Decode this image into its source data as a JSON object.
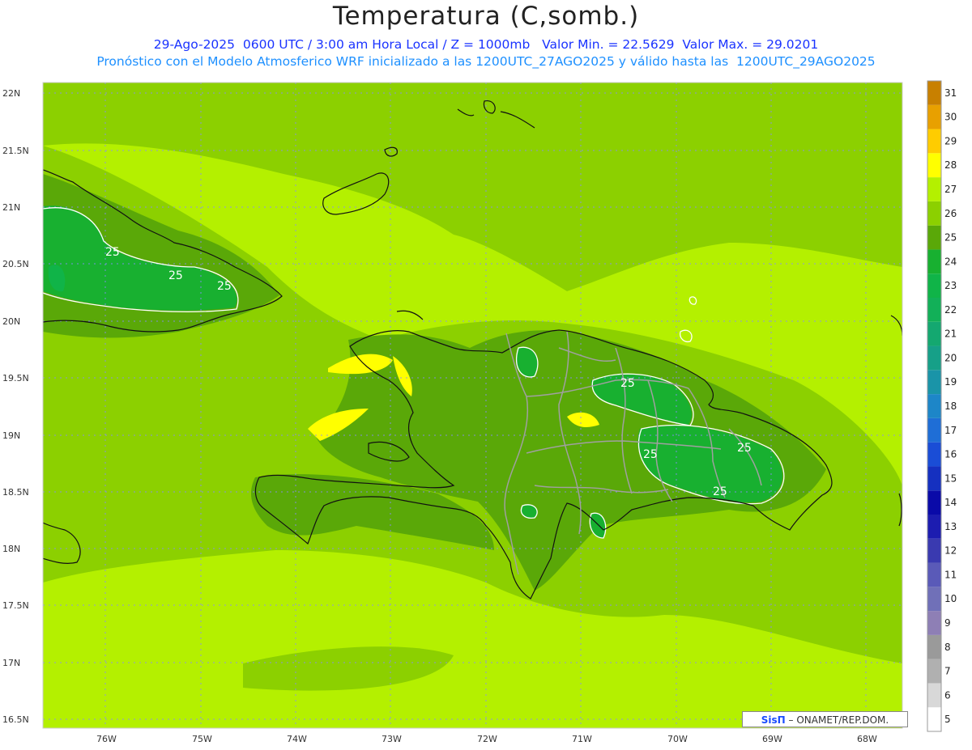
{
  "header": {
    "title": "Temperatura (C,somb.)",
    "line1": "29-Ago-2025  0600 UTC / 3:00 am Hora Local / Z = 1000mb   Valor Min. = 22.5629  Valor Max. = 29.0201",
    "line2": "Pronóstico con el Modelo Atmosferico WRF inicializado a las 1200UTC_27AGO2025 y válido hasta las  1200UTC_29AGO2025"
  },
  "axes": {
    "lat_labels": [
      "22N",
      "21.5N",
      "21N",
      "20.5N",
      "20N",
      "19.5N",
      "19N",
      "18.5N",
      "18N",
      "17.5N",
      "17N",
      "16.5N"
    ],
    "lon_labels": [
      "76W",
      "75W",
      "74W",
      "73W",
      "72W",
      "71W",
      "70W",
      "69W",
      "68W"
    ]
  },
  "colorbar": {
    "levels": [
      "5",
      "6",
      "7",
      "8",
      "9",
      "10",
      "11",
      "12",
      "13",
      "14",
      "15",
      "16",
      "17",
      "18",
      "19",
      "20",
      "21",
      "22",
      "23",
      "24",
      "25",
      "26",
      "27",
      "28",
      "29",
      "30",
      "31"
    ],
    "colors": [
      "#ffffff",
      "#d8d8d8",
      "#b0b0b0",
      "#9a9a9a",
      "#8e7fb5",
      "#7070b8",
      "#5a5ab8",
      "#3a3ab0",
      "#1c1cb0",
      "#0a0aa8",
      "#1530c0",
      "#1a4dd6",
      "#1f6ed6",
      "#1d86c8",
      "#1a94a8",
      "#16a088",
      "#14a870",
      "#12b058",
      "#10b448",
      "#18b030",
      "#5aa808",
      "#8cd000",
      "#b4f000",
      "#ffff00",
      "#ffcc00",
      "#e8a000",
      "#c88000"
    ]
  },
  "contour_labels": [
    "25",
    "25",
    "25",
    "25",
    "25",
    "25",
    "25"
  ],
  "credit": {
    "brand": "SisΠ",
    "text": " – ONAMET/REP.DOM."
  }
}
